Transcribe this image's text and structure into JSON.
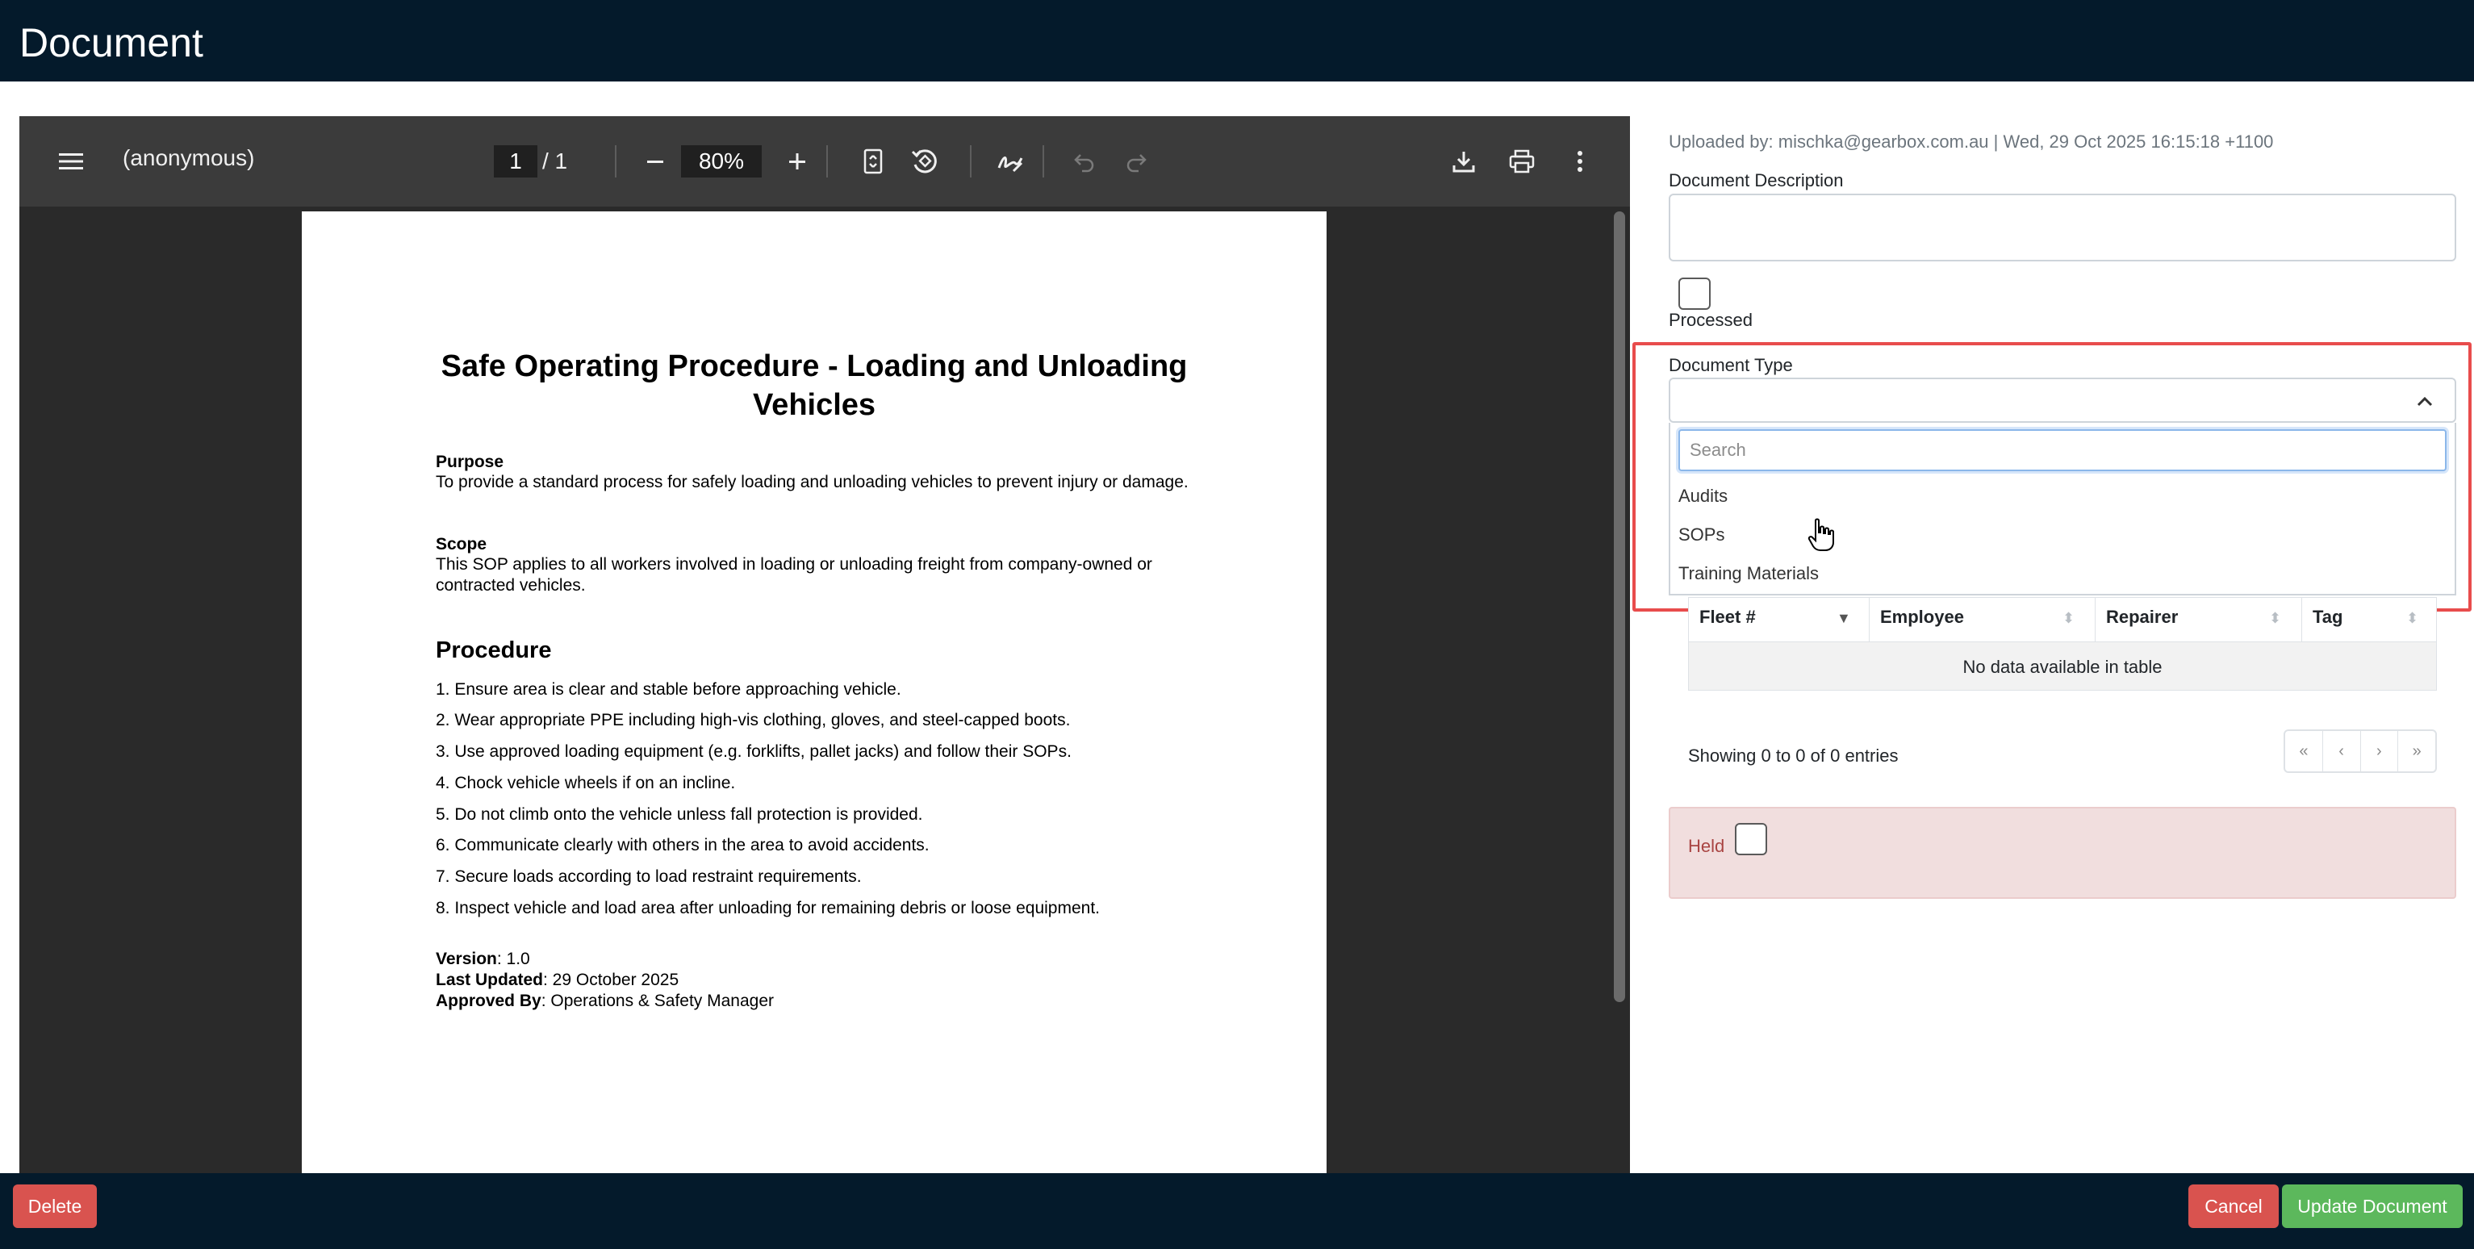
{
  "header": {
    "title": "Document"
  },
  "pdf_toolbar": {
    "document_name": "(anonymous)",
    "page_current": "1",
    "page_total": "/  1",
    "zoom": "80%"
  },
  "pdf_page": {
    "title": "Safe Operating Procedure - Loading and Unloading Vehicles",
    "purpose_heading": "Purpose",
    "purpose_text": "To provide a standard process for safely loading and unloading vehicles to prevent injury or damage.",
    "scope_heading": "Scope",
    "scope_text": "This SOP applies to all workers involved in loading or unloading freight from company-owned or contracted vehicles.",
    "procedure_heading": "Procedure",
    "steps": [
      "1. Ensure area is clear and stable before approaching vehicle.",
      "2. Wear appropriate PPE including high-vis clothing, gloves, and steel-capped boots.",
      "3. Use approved loading equipment (e.g. forklifts, pallet jacks) and follow their SOPs.",
      "4. Chock vehicle wheels if on an incline.",
      "5. Do not climb onto the vehicle unless fall protection is provided.",
      "6. Communicate clearly with others in the area to avoid accidents.",
      "7. Secure loads according to load restraint requirements.",
      "8. Inspect vehicle and load area after unloading for remaining debris or loose equipment."
    ],
    "version_label": "Version",
    "version_value": ": 1.0",
    "updated_label": "Last Updated",
    "updated_value": ": 29 October 2025",
    "approved_label": "Approved By",
    "approved_value": ": Operations & Safety Manager"
  },
  "form": {
    "uploaded_by": "Uploaded by: mischka@gearbox.com.au | Wed, 29 Oct 2025 16:15:18 +1100",
    "description_label": "Document Description",
    "processed_label": "Processed",
    "doc_type_label": "Document Type",
    "search_placeholder": "Search",
    "options": [
      "Audits",
      "SOPs",
      "Training Materials"
    ]
  },
  "table": {
    "columns": [
      "Fleet #",
      "Employee",
      "Repairer",
      "Tag"
    ],
    "empty_text": "No data available in table",
    "info": "Showing 0 to 0 of 0 entries",
    "pager": [
      "«",
      "‹",
      "›",
      "»"
    ]
  },
  "held": {
    "label": "Held"
  },
  "footer": {
    "delete_label": "Delete",
    "cancel_label": "Cancel",
    "update_label": "Update Document"
  },
  "colors": {
    "header_bg": "#041a2b",
    "danger": "#d9534f",
    "success": "#5cb85c",
    "highlight": "#e84c4c"
  }
}
